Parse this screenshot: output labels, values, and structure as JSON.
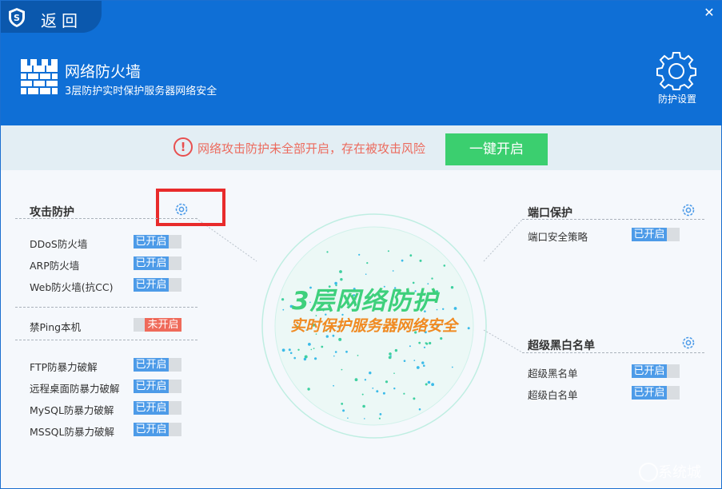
{
  "header": {
    "back_label": "返回",
    "close_symbol": "✕",
    "title": "网络防火墙",
    "subtitle": "3层防护实时保护服务器网络安全",
    "settings_label": "防护设置",
    "colors": {
      "background": "#0f6fd6",
      "back_tab": "#0b58ad"
    }
  },
  "warning": {
    "icon_text": "!",
    "text": "网络攻击防护未全部开启，存在被攻击风险",
    "button_label": "一键开启"
  },
  "attack": {
    "title": "攻击防护",
    "group1": [
      {
        "label": "DDoS防火墙",
        "status": "已开启"
      },
      {
        "label": "ARP防火墙",
        "status": "已开启"
      },
      {
        "label": "Web防火墙(抗CC)",
        "status": "已开启"
      }
    ],
    "group2": [
      {
        "label": "禁Ping本机",
        "status": "未开启"
      }
    ],
    "group3": [
      {
        "label": "FTP防暴力破解",
        "status": "已开启"
      },
      {
        "label": "远程桌面防暴力破解",
        "status": "已开启"
      },
      {
        "label": "MySQL防暴力破解",
        "status": "已开启"
      },
      {
        "label": "MSSQL防暴力破解",
        "status": "已开启"
      }
    ]
  },
  "port": {
    "title": "端口保护",
    "items": [
      {
        "label": "端口安全策略",
        "status": "已开启"
      }
    ]
  },
  "blackwhite": {
    "title": "超级黑白名单",
    "items": [
      {
        "label": "超级黑名单",
        "status": "已开启"
      },
      {
        "label": "超级白名单",
        "status": "已开启"
      }
    ]
  },
  "center": {
    "title": "3层网络防护",
    "subtitle": "实时保护服务器网络安全"
  },
  "watermark": "系统城",
  "colors": {
    "on": "#4d9be8",
    "off": "#ef6a5a",
    "accent_green": "#3bcf6f",
    "warning_text": "#ec6b5e"
  },
  "icons": [
    "shield-logo",
    "close-icon",
    "firewall-wall-icon",
    "settings-gear-icon",
    "warning-icon",
    "gear-icon"
  ]
}
